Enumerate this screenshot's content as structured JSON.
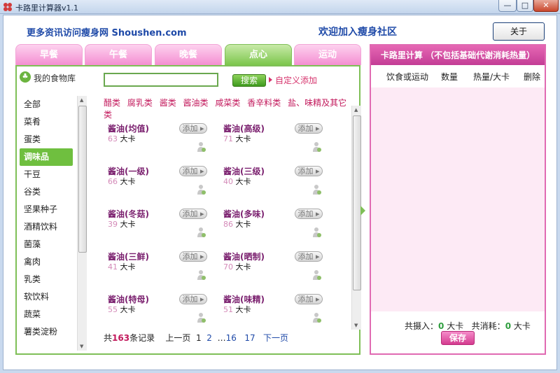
{
  "window": {
    "title": "卡路里计算器v1.1",
    "min": "—",
    "max": "□",
    "close": "✕"
  },
  "header": {
    "promo": "更多资讯访问瘦身网 Shoushen.com",
    "join": "欢迎加入瘦身社区",
    "about": "关于"
  },
  "tabs": [
    {
      "label": "早餐"
    },
    {
      "label": "午餐"
    },
    {
      "label": "晚餐"
    },
    {
      "label": "点心",
      "active": true
    },
    {
      "label": "运动"
    }
  ],
  "library": {
    "label": "我的食物库",
    "icon": "leaf-icon"
  },
  "search": {
    "placeholder": "",
    "value": "",
    "button": "搜索",
    "custom": "自定义添加"
  },
  "categories": [
    "全部",
    "菜肴",
    "蛋类",
    "调味品",
    "干豆",
    "谷类",
    "坚果种子",
    "酒精饮料",
    "菌藻",
    "禽肉",
    "乳类",
    "软饮料",
    "蔬菜",
    "薯类淀粉"
  ],
  "active_category": "调味品",
  "subcategories": [
    "醋类",
    "腐乳类",
    "酱类",
    "酱油类",
    "咸菜类",
    "香辛料类",
    "盐、味精及其它类"
  ],
  "foods": [
    {
      "name": "酱油(均值)",
      "kcal": "63",
      "unit": "大卡",
      "add": "添加"
    },
    {
      "name": "酱油(高级)",
      "kcal": "71",
      "unit": "大卡",
      "add": "添加"
    },
    {
      "name": "酱油(一级)",
      "kcal": "66",
      "unit": "大卡",
      "add": "添加"
    },
    {
      "name": "酱油(三级)",
      "kcal": "40",
      "unit": "大卡",
      "add": "添加"
    },
    {
      "name": "酱油(冬菇)",
      "kcal": "39",
      "unit": "大卡",
      "add": "添加"
    },
    {
      "name": "酱油(多味)",
      "kcal": "86",
      "unit": "大卡",
      "add": "添加"
    },
    {
      "name": "酱油(三鲜)",
      "kcal": "41",
      "unit": "大卡",
      "add": "添加"
    },
    {
      "name": "酱油(晒制)",
      "kcal": "70",
      "unit": "大卡",
      "add": "添加"
    },
    {
      "name": "酱油(特母)",
      "kcal": "55",
      "unit": "大卡",
      "add": "添加"
    },
    {
      "name": "酱油(味精)",
      "kcal": "51",
      "unit": "大卡",
      "add": "添加"
    }
  ],
  "pager": {
    "pre": "共",
    "total": "163",
    "post": "条记录",
    "prev": "上一页",
    "p1": "1",
    "p2": "2",
    "dots": "…",
    "p16": "16",
    "p17": "17",
    "next": "下一页"
  },
  "calc": {
    "title": "卡路里计算 （不包括基础代谢消耗热量）",
    "columns": [
      "饮食或运动",
      "数量",
      "热量/大卡",
      "删除"
    ],
    "intake_label": "共摄入：",
    "intake_value": "0",
    "intake_unit": "大卡",
    "burn_label": "共消耗：",
    "burn_value": "0",
    "burn_unit": "大卡",
    "save": "保存"
  },
  "colors": {
    "green": "#7fbf57",
    "pink": "#e06ab2",
    "link_blue": "#1f4aa8",
    "accent_red": "#c2185b"
  }
}
